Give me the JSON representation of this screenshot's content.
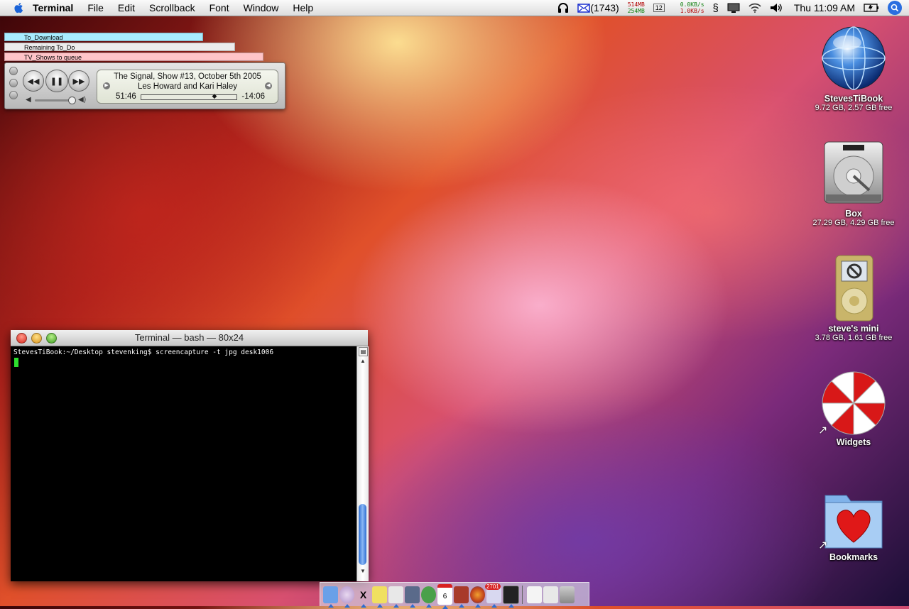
{
  "menubar": {
    "app_name": "Terminal",
    "menus": [
      "File",
      "Edit",
      "Scrollback",
      "Font",
      "Window",
      "Help"
    ],
    "mail_count": "(1743)",
    "mem_used": "514MB",
    "mem_free": "254MB",
    "calendar_day": "12",
    "net_in": "0.0KB/s",
    "net_out": "1.0KB/s",
    "clock": "Thu 11:09 AM"
  },
  "stickies": [
    {
      "label": "To_Download",
      "color": "#a8ecff"
    },
    {
      "label": "Remaining To_Do",
      "color": "#ececec"
    },
    {
      "label": "TV_Shows to queue",
      "color": "#ffc4c8"
    }
  ],
  "player": {
    "track": "The Signal, Show #13, October 5th 2005",
    "artist": "Les Howard and Kari Haley",
    "elapsed": "51:46",
    "remaining": "-14:06",
    "progress": 0.78
  },
  "terminal": {
    "title": "Terminal — bash — 80x24",
    "prompt_line": "StevesTiBook:~/Desktop stevenking$ screencapture -t jpg desk1006"
  },
  "desktop_icons": [
    {
      "name": "StevesTiBook",
      "sub": "9.72 GB, 2.57 GB free",
      "icon": "globe-icon"
    },
    {
      "name": "Box",
      "sub": "27.29 GB, 4.29 GB free",
      "icon": "hard-drive-icon"
    },
    {
      "name": "steve's mini",
      "sub": "3.78 GB, 1.61 GB free",
      "icon": "ipod-mini-icon"
    },
    {
      "name": "Widgets",
      "sub": "",
      "icon": "umbrella-icon"
    },
    {
      "name": "Bookmarks",
      "sub": "",
      "icon": "heart-folder-icon"
    }
  ],
  "dock": {
    "badge": "2701",
    "calendar_day": "6"
  }
}
